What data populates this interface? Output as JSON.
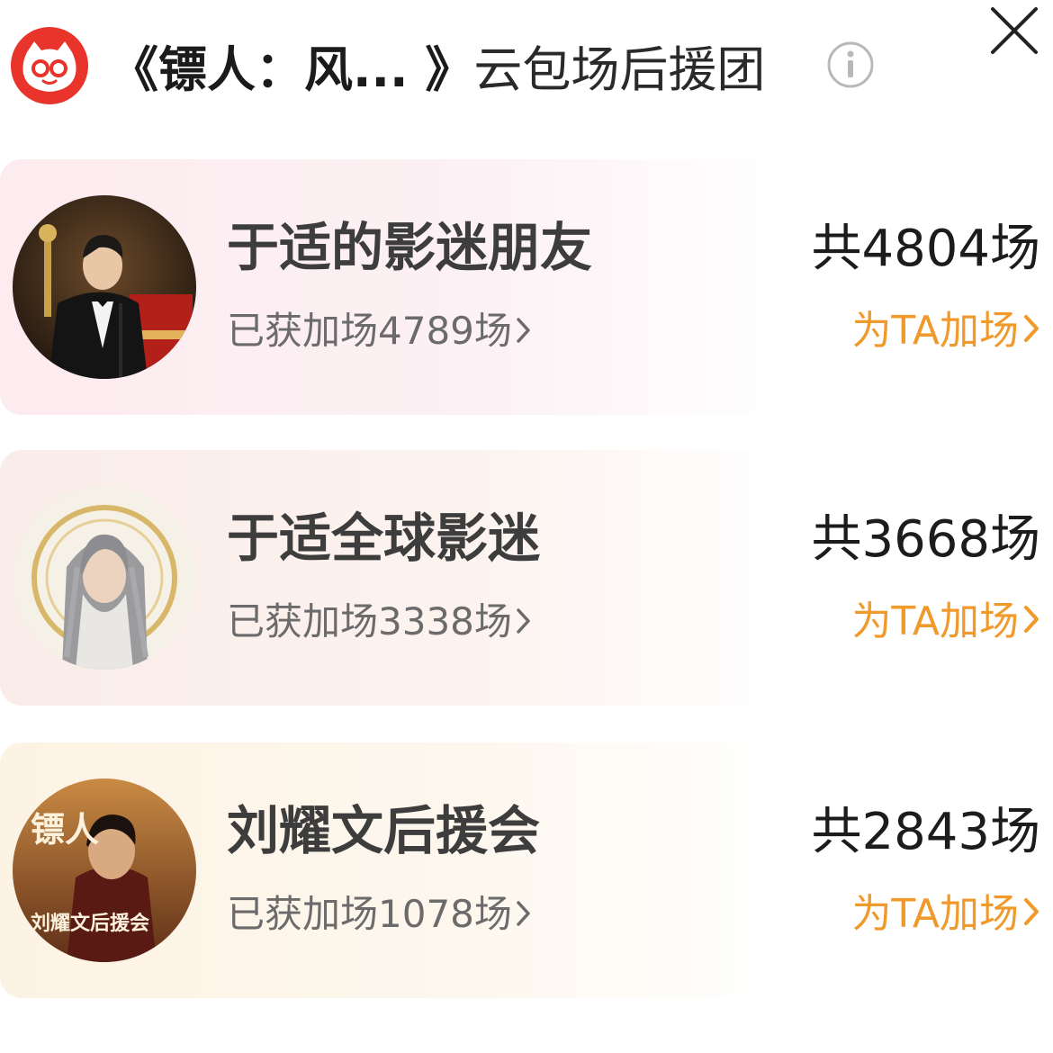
{
  "header": {
    "movie_title": "《镖人：风... 》",
    "suffix": "云包场后援团"
  },
  "colors": {
    "accent": "#f09a2c",
    "logo": "#e8342b"
  },
  "icons": {
    "logo": "cat-eye-logo-icon",
    "info": "info-icon",
    "close": "close-icon"
  },
  "groups": [
    {
      "name": "于适的影迷朋友",
      "got": "已获加场4789场",
      "total": "共4804场",
      "cta": "为TA加场"
    },
    {
      "name": "于适全球影迷",
      "got": "已获加场3338场",
      "total": "共3668场",
      "cta": "为TA加场"
    },
    {
      "name": "刘耀文后援会",
      "got": "已获加场1078场",
      "total": "共2843场",
      "cta": "为TA加场"
    }
  ],
  "avatar3_text": {
    "title_art": "镖人",
    "banner": "刘耀文后援会"
  }
}
